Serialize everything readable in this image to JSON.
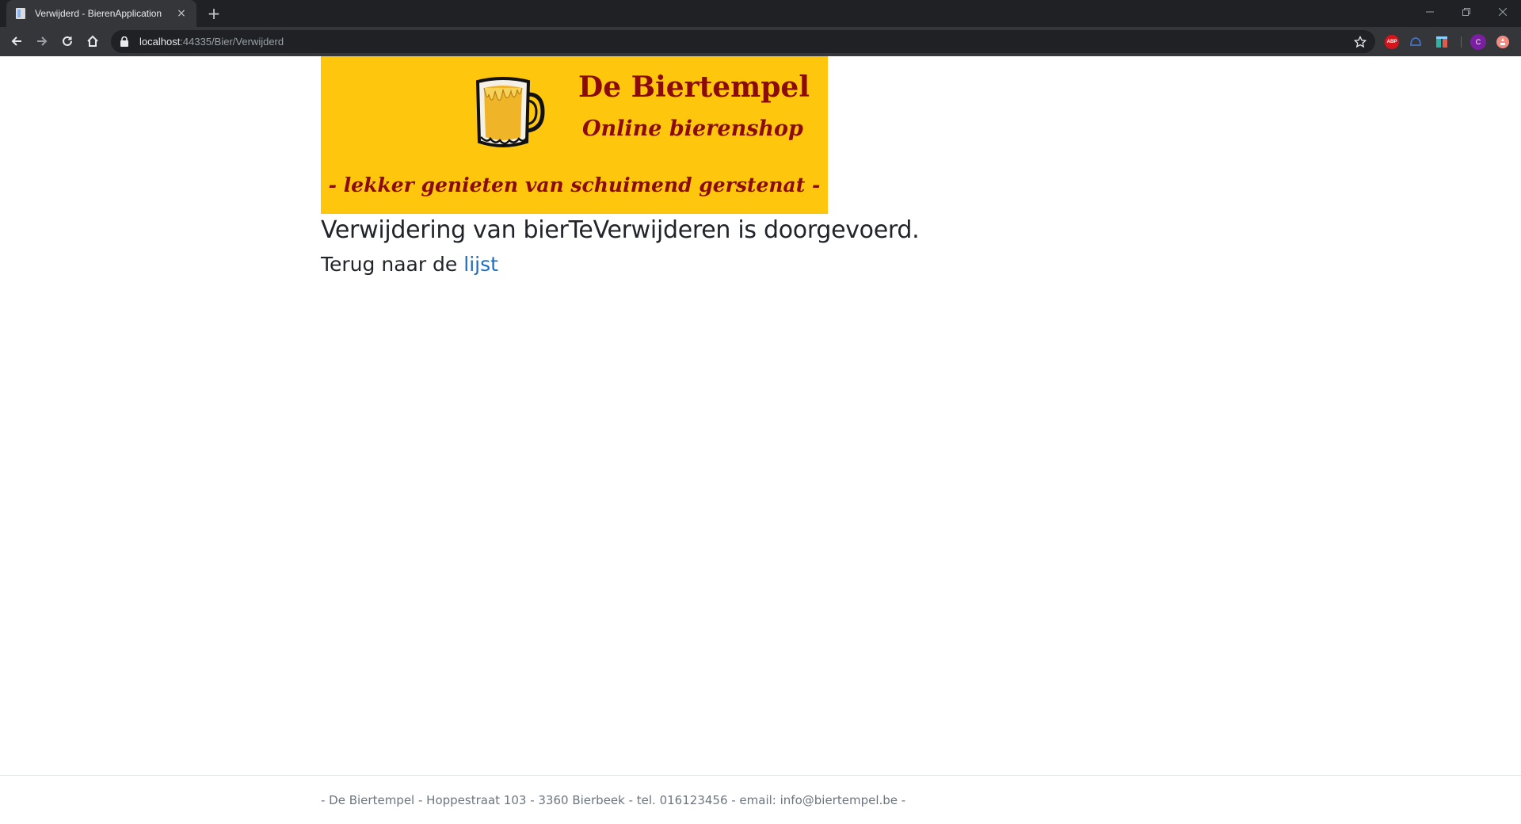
{
  "browser": {
    "tab_title": "Verwijderd - BierenApplication",
    "tab_close_glyph": "×",
    "new_tab_glyph": "+",
    "url_host": "localhost",
    "url_rest": ":44335/Bier/Verwijderd",
    "extensions": [
      {
        "name": "adblock-plus-icon",
        "label": "ABP"
      },
      {
        "name": "extension-icon"
      },
      {
        "name": "extension-icon"
      }
    ],
    "profile_initial": "C"
  },
  "banner": {
    "title": "De Biertempel",
    "subtitle": "Online bierenshop",
    "slogan": "- lekker genieten van schuimend gerstenat -",
    "background_color": "#fec70d",
    "text_color": "#8b0a0a"
  },
  "content": {
    "message": "Verwijdering van bierTeVerwijderen is doorgevoerd.",
    "back_prefix": "Terug naar de ",
    "back_link": "lijst"
  },
  "footer": {
    "text": "- De Biertempel - Hoppestraat 103 - 3360 Bierbeek - tel. 016123456 - email: info@biertempel.be -"
  }
}
